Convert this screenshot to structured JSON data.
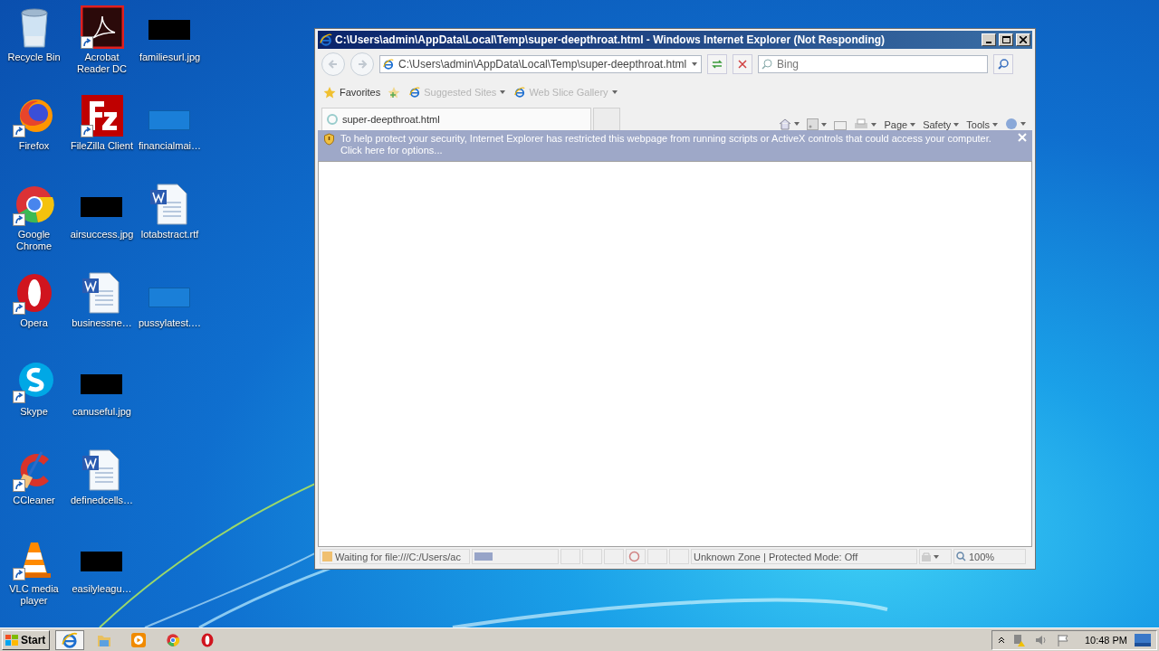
{
  "desktop": {
    "icons": [
      {
        "label": "Recycle Bin",
        "kind": "bin",
        "shortcut": false
      },
      {
        "label": "Firefox",
        "kind": "fox",
        "shortcut": true
      },
      {
        "label": "Google Chrome",
        "kind": "wheel",
        "shortcut": true
      },
      {
        "label": "Opera",
        "kind": "ring",
        "shortcut": true
      },
      {
        "label": "Skype",
        "kind": "bubble",
        "shortcut": true
      },
      {
        "label": "CCleaner",
        "kind": "broom",
        "shortcut": true
      },
      {
        "label": "VLC media player",
        "kind": "cone",
        "shortcut": true
      },
      {
        "label": "Acrobat Reader DC",
        "kind": "pdf",
        "shortcut": true
      },
      {
        "label": "FileZilla Client",
        "kind": "ftp",
        "shortcut": true
      },
      {
        "label": "airsuccess.jpg",
        "kind": "photo",
        "shortcut": false
      },
      {
        "label": "businessne…",
        "kind": "doc",
        "shortcut": false
      },
      {
        "label": "canuseful.jpg",
        "kind": "photo",
        "shortcut": false
      },
      {
        "label": "definedcells…",
        "kind": "doc",
        "shortcut": false
      },
      {
        "label": "easilyleagu…",
        "kind": "photo",
        "shortcut": false
      },
      {
        "label": "familiesurl.jpg",
        "kind": "photo",
        "shortcut": false
      },
      {
        "label": "financialmai…",
        "kind": "blank",
        "shortcut": false
      },
      {
        "label": "lotabstract.rtf",
        "kind": "doc",
        "shortcut": false
      },
      {
        "label": "pussylatest.…",
        "kind": "blank",
        "shortcut": false
      }
    ]
  },
  "browser": {
    "title": "C:\\Users\\admin\\AppData\\Local\\Temp\\super-deepthroat.html - Windows Internet Explorer (Not Responding)",
    "address": "C:\\Users\\admin\\AppData\\Local\\Temp\\super-deepthroat.html",
    "search_placeholder": "Bing",
    "favorites": "Favorites",
    "favorites_items": [
      {
        "label": "Suggested Sites",
        "disabled": true
      },
      {
        "label": "Web Slice Gallery",
        "disabled": true
      }
    ],
    "tabs": [
      {
        "label": "super-deepthroat.html",
        "selected": true
      }
    ],
    "commands": [
      "Page",
      "Safety",
      "Tools"
    ],
    "info_bar": "To help protect your security, Internet Explorer has restricted this webpage from running scripts or ActiveX controls that could access your computer. Click here for options...",
    "status": {
      "text": "Waiting for file:///C:/Users/ac",
      "level": 0.22,
      "zone": "Unknown Zone | Protected Mode: Off",
      "zoom": "100%"
    }
  },
  "taskbar": {
    "start": "Start",
    "apps": [
      {
        "kind": "ie",
        "selected": true
      },
      {
        "kind": "folder",
        "selected": false
      },
      {
        "kind": "player",
        "selected": false
      },
      {
        "kind": "wheel",
        "selected": false
      },
      {
        "kind": "ring",
        "selected": false
      }
    ],
    "clock": "10:48 PM"
  }
}
